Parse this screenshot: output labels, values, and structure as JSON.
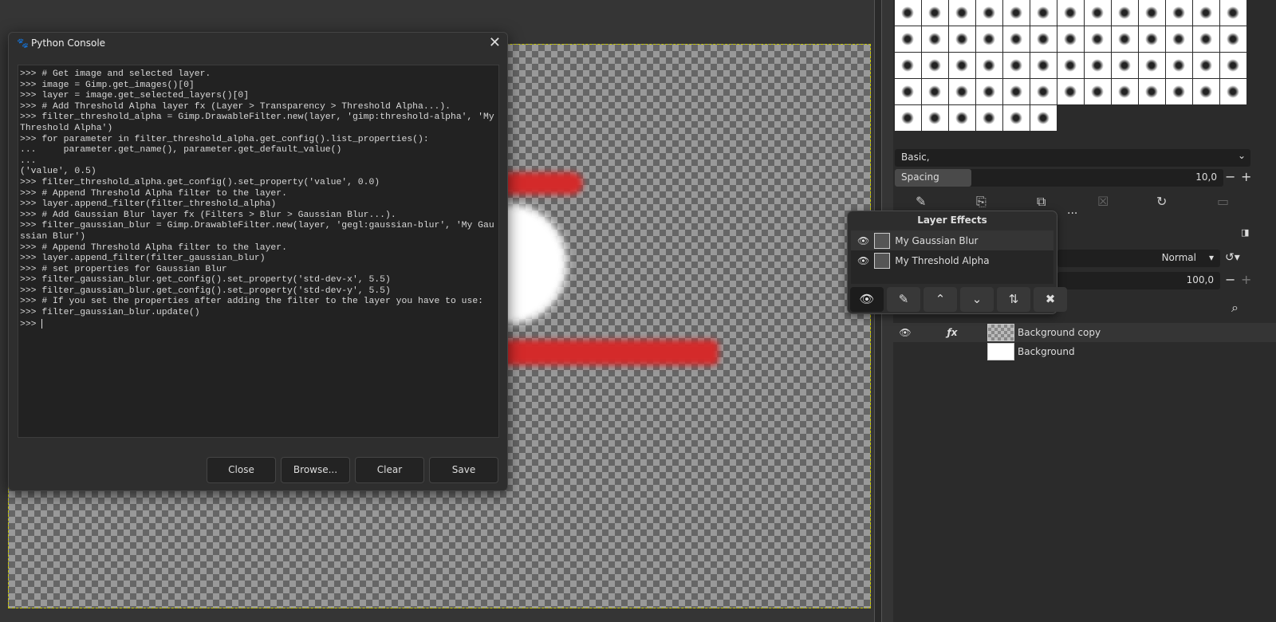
{
  "console": {
    "title": "Python Console",
    "lines": [
      ">>> # Get image and selected layer.",
      ">>> image = Gimp.get_images()[0]",
      ">>> layer = image.get_selected_layers()[0]",
      ">>> # Add Threshold Alpha layer fx (Layer > Transparency > Threshold Alpha...).",
      ">>> filter_threshold_alpha = Gimp.DrawableFilter.new(layer, 'gimp:threshold-alpha', 'My Threshold Alpha')",
      ">>> for parameter in filter_threshold_alpha.get_config().list_properties():",
      "...     parameter.get_name(), parameter.get_default_value()",
      "...",
      "('value', 0.5)",
      ">>> filter_threshold_alpha.get_config().set_property('value', 0.0)",
      ">>> # Append Threshold Alpha filter to the layer.",
      ">>> layer.append_filter(filter_threshold_alpha)",
      ">>> # Add Gaussian Blur layer fx (Filters > Blur > Gaussian Blur...).",
      ">>> filter_gaussian_blur = Gimp.DrawableFilter.new(layer, 'gegl:gaussian-blur', 'My Gaussian Blur')",
      ">>> # Append Threshold Alpha filter to the layer.",
      ">>> layer.append_filter(filter_gaussian_blur)",
      ">>> # set properties for Gaussian Blur",
      ">>> filter_gaussian_blur.get_config().set_property('std-dev-x', 5.5)",
      ">>> filter_gaussian_blur.get_config().set_property('std-dev-y', 5.5)",
      ">>> # If you set the properties after adding the filter to the layer you have to use:",
      ">>> filter_gaussian_blur.update()"
    ],
    "prompt": ">>> ",
    "buttons": {
      "close": "Close",
      "browse": "Browse...",
      "clear": "Clear",
      "save": "Save"
    }
  },
  "brushes": {
    "preset": "Basic,",
    "spacing_label": "Spacing",
    "spacing_value": "10,0",
    "spacing_fraction": 0.1
  },
  "layer_effects": {
    "title": "Layer Effects",
    "items": [
      "My Gaussian Blur",
      "My Threshold Alpha"
    ]
  },
  "layers": {
    "mode": "Normal",
    "opacity": "100,0",
    "items": [
      "Background copy",
      "Background"
    ],
    "fx_label": "ƒx"
  }
}
